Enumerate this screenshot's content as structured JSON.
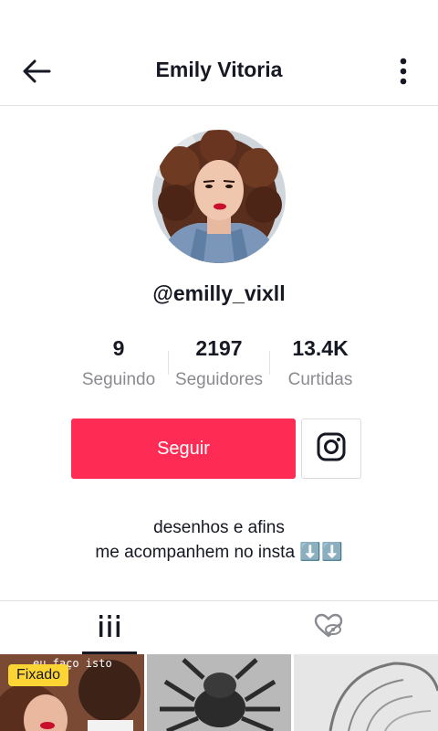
{
  "header": {
    "title": "Emily Vitoria"
  },
  "profile": {
    "username": "@emilly_vixll",
    "stats": [
      {
        "value": "9",
        "label": "Seguindo"
      },
      {
        "value": "2197",
        "label": "Seguidores"
      },
      {
        "value": "13.4K",
        "label": "Curtidas"
      }
    ],
    "follow_label": "Seguir",
    "bio_line1": "desenhos e afins",
    "bio_line2": "me acompanhem no insta ⬇️⬇️"
  },
  "videos": [
    {
      "badge": "Fixado",
      "overlay_text": "eu faço isto"
    },
    {},
    {}
  ],
  "colors": {
    "accent": "#fe2c55",
    "pinned": "#fcd535",
    "text_primary": "#161823",
    "text_secondary": "#8a8b91"
  }
}
